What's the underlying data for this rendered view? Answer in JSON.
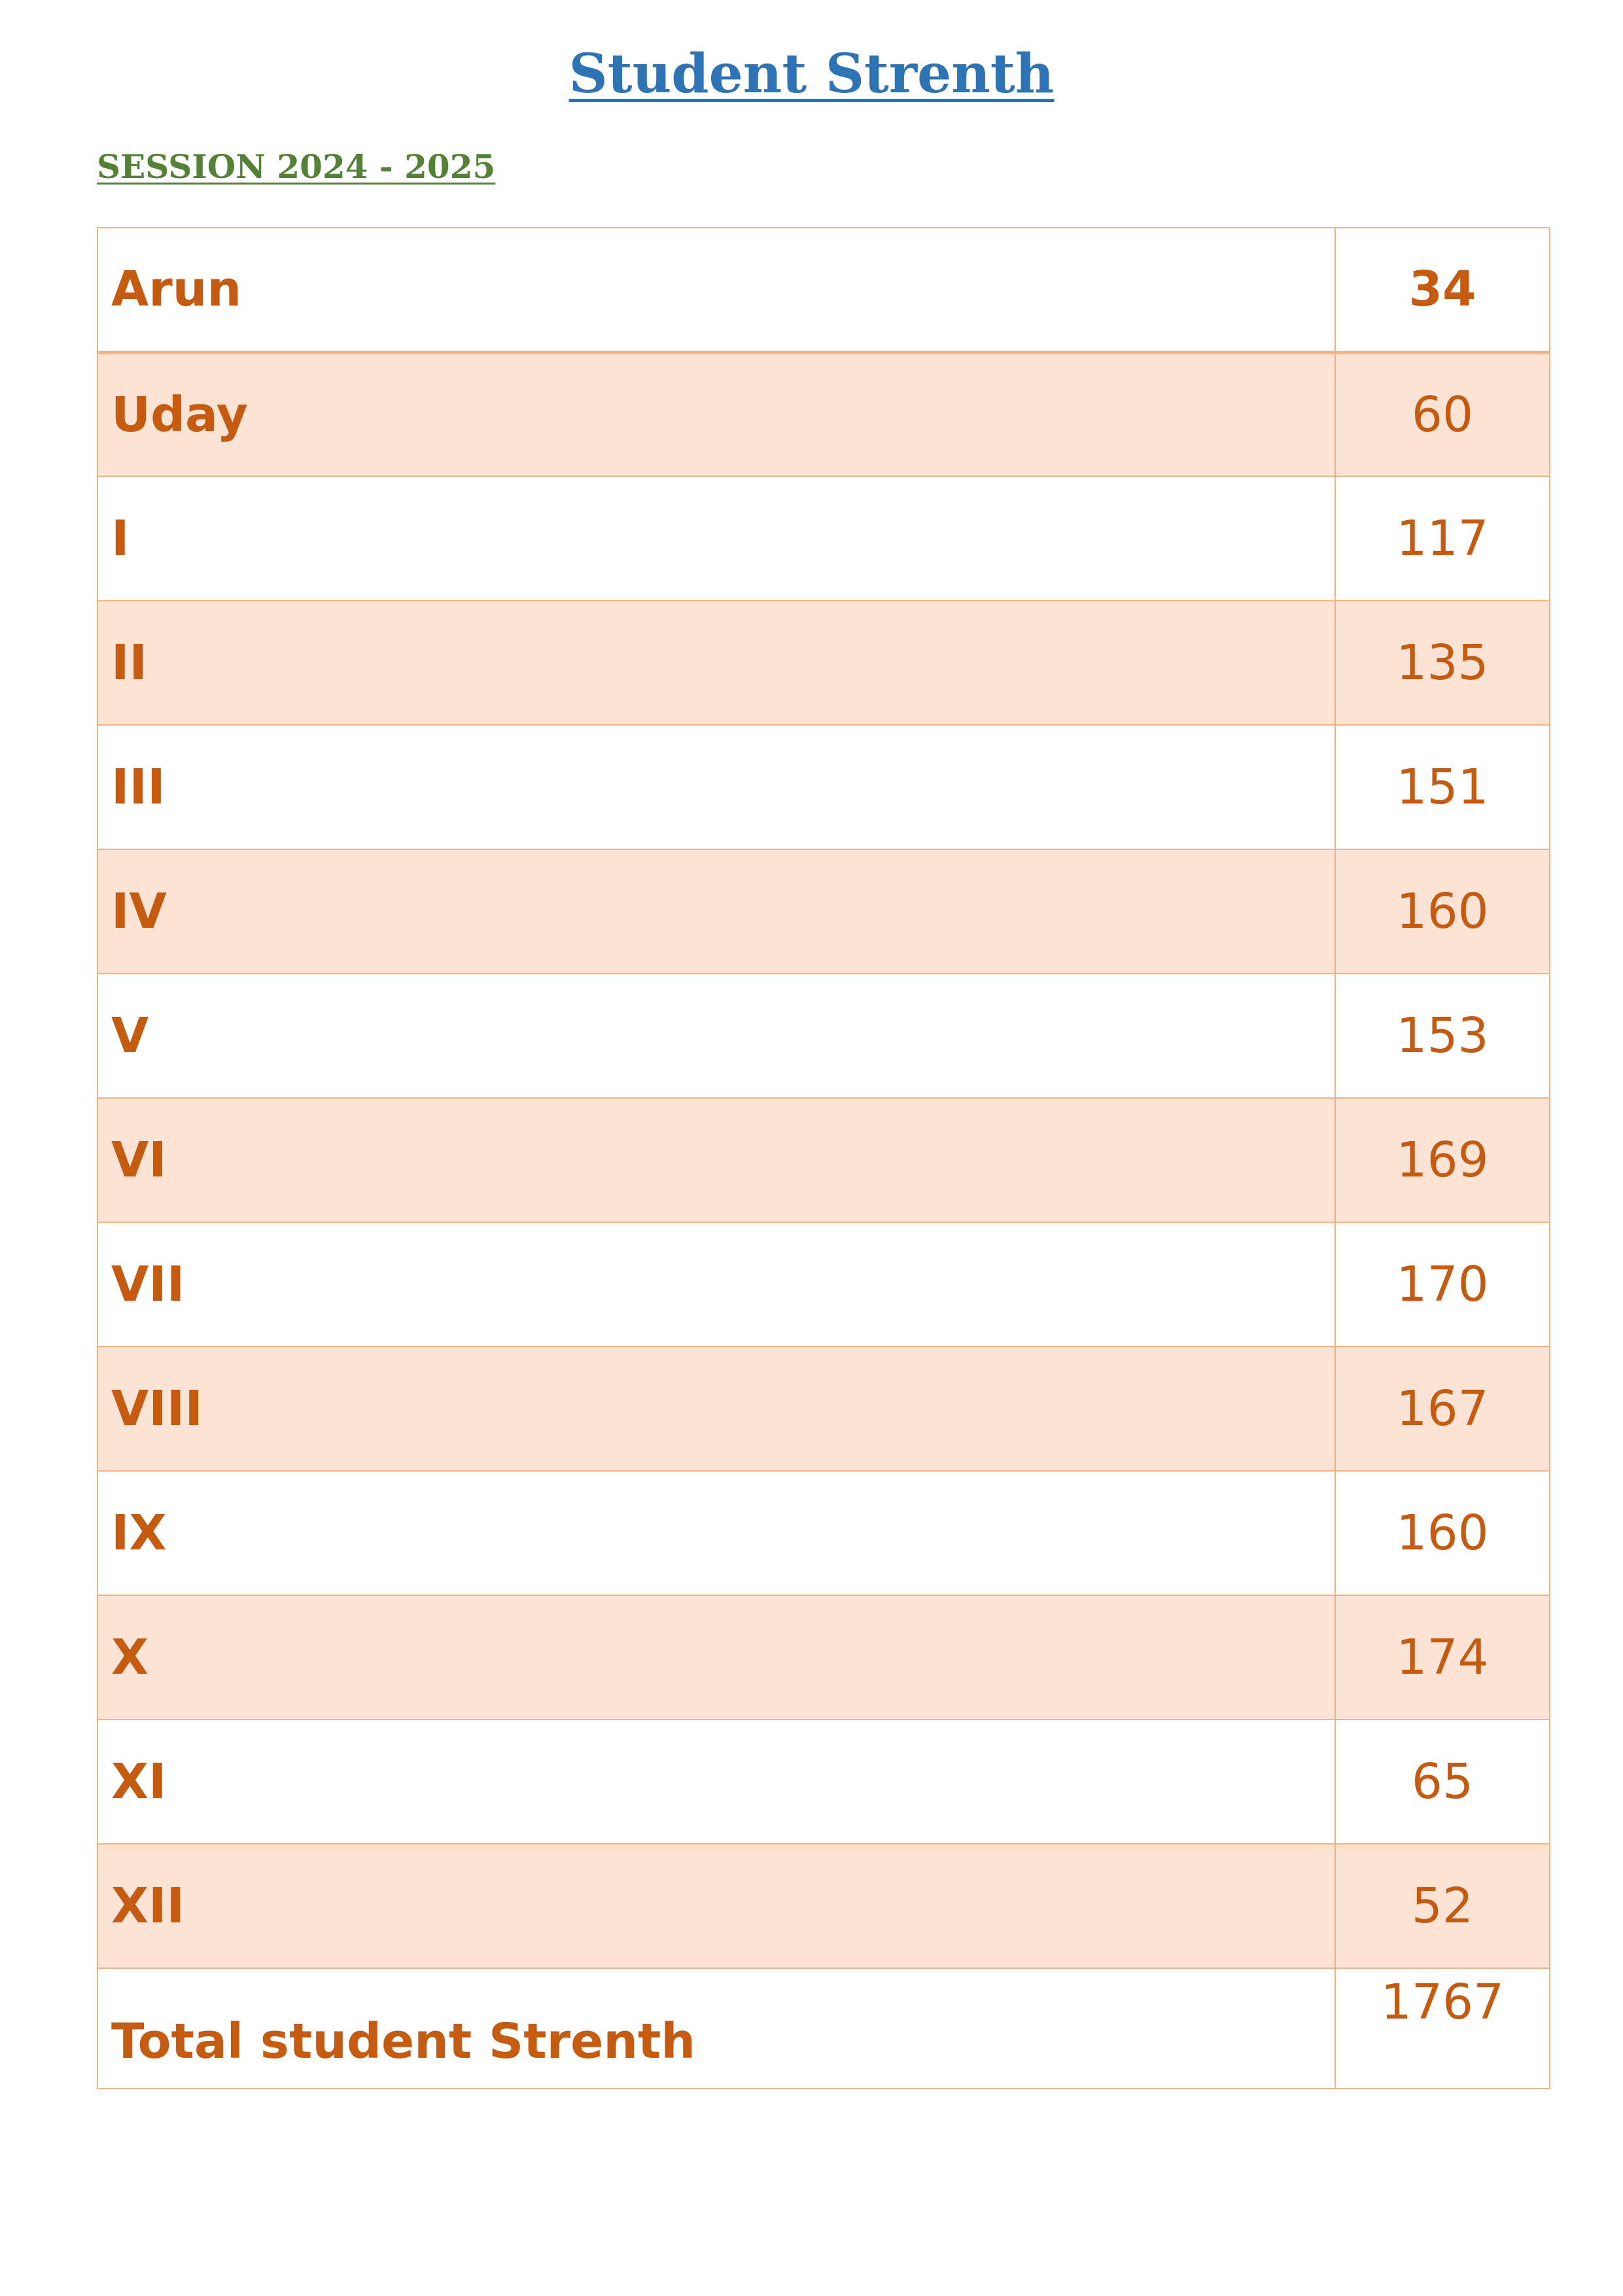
{
  "title": "Student Strenth",
  "session": "SESSION 2024 - 2025",
  "rows": [
    {
      "label": "Arun",
      "value": "34"
    },
    {
      "label": "Uday",
      "value": "60"
    },
    {
      "label": "I",
      "value": "117"
    },
    {
      "label": "II",
      "value": "135"
    },
    {
      "label": "III",
      "value": "151"
    },
    {
      "label": "IV",
      "value": "160"
    },
    {
      "label": "V",
      "value": "153"
    },
    {
      "label": "VI",
      "value": "169"
    },
    {
      "label": "VII",
      "value": "170"
    },
    {
      "label": "VIII",
      "value": "167"
    },
    {
      "label": "IX",
      "value": "160"
    },
    {
      "label": "X",
      "value": "174"
    },
    {
      "label": "XI",
      "value": "65"
    },
    {
      "label": "XII",
      "value": "52"
    }
  ],
  "total": {
    "label": "Total student Strenth",
    "value": "1767"
  },
  "colors": {
    "title": "#2e74b5",
    "session": "#538135",
    "text": "#c55a11",
    "border": "#f4b183",
    "band": "#fbe4d5"
  }
}
